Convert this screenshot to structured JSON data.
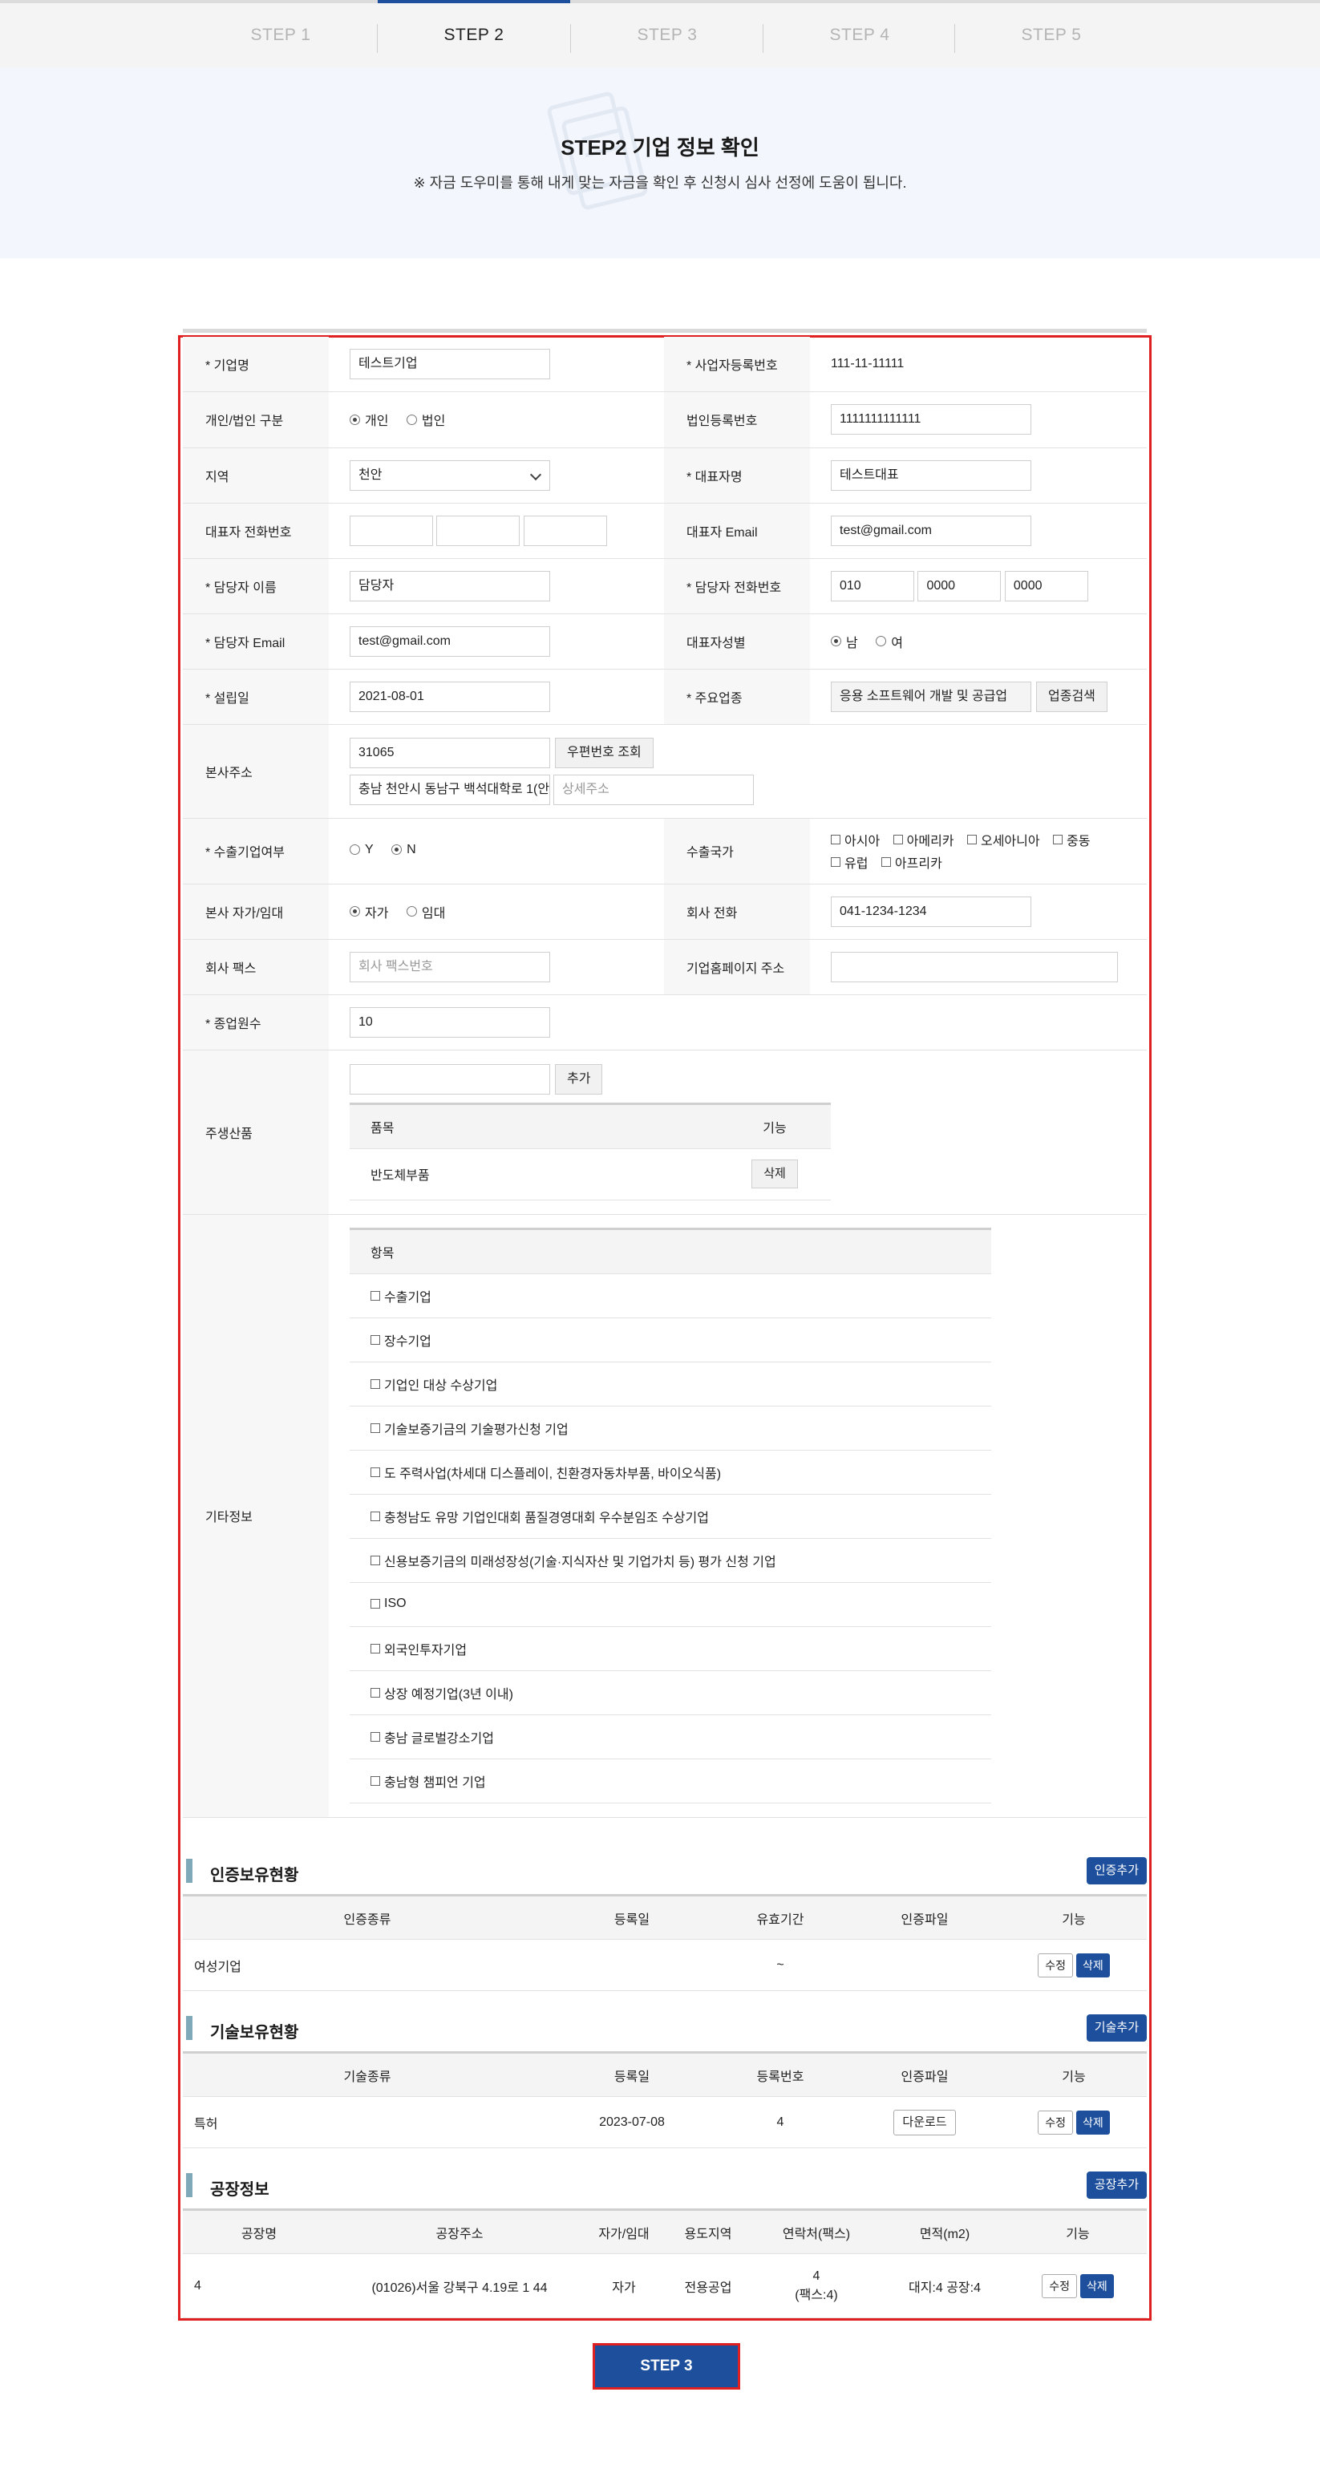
{
  "steps": [
    "STEP 1",
    "STEP 2",
    "STEP 3",
    "STEP 4",
    "STEP 5"
  ],
  "active_step_index": 1,
  "hero": {
    "title": "STEP2 기업 정보 확인",
    "subtitle": "※ 자금 도우미를 통해 내게 맞는 자금을 확인 후 신청시 심사 선정에 도움이 됩니다."
  },
  "form": {
    "company_name": {
      "label": "* 기업명",
      "value": "테스트기업"
    },
    "biz_reg_no": {
      "label": "* 사업자등록번호",
      "value": "111-11-11111"
    },
    "entity_type": {
      "label": "개인/법인 구분",
      "options": [
        "개인",
        "법인"
      ],
      "selected": "개인"
    },
    "corp_reg_no": {
      "label": "법인등록번호",
      "value": "1111111111111"
    },
    "region": {
      "label": "지역",
      "value": "천안"
    },
    "ceo_name": {
      "label": "* 대표자명",
      "value": "테스트대표"
    },
    "ceo_phone": {
      "label": "대표자 전화번호",
      "values": [
        "",
        "",
        ""
      ]
    },
    "ceo_email": {
      "label": "대표자 Email",
      "value": "test@gmail.com"
    },
    "manager_name": {
      "label": "* 담당자 이름",
      "value": "담당자"
    },
    "manager_phone": {
      "label": "* 담당자 전화번호",
      "values": [
        "010",
        "0000",
        "0000"
      ]
    },
    "manager_email": {
      "label": "* 담당자 Email",
      "value": "test@gmail.com"
    },
    "ceo_gender": {
      "label": "대표자성별",
      "options": [
        "남",
        "여"
      ],
      "selected": "남"
    },
    "founded": {
      "label": "* 설립일",
      "value": "2021-08-01"
    },
    "main_industry": {
      "label": "* 주요업종",
      "value": "응용 소프트웨어 개발 및 공급업",
      "button": "업종검색"
    },
    "hq_address": {
      "label": "본사주소",
      "zipcode": "31065",
      "zip_button": "우편번호 조회",
      "address": "충남 천안시 동남구 백석대학로 1(안",
      "detail_placeholder": "상세주소"
    },
    "exporter": {
      "label": "* 수출기업여부",
      "options": [
        "Y",
        "N"
      ],
      "selected": "N"
    },
    "export_countries": {
      "label": "수출국가",
      "options": [
        "아시아",
        "아메리카",
        "오세아니아",
        "중동",
        "유럽",
        "아프리카"
      ]
    },
    "hq_ownership": {
      "label": "본사 자가/임대",
      "options": [
        "자가",
        "임대"
      ],
      "selected": "자가"
    },
    "company_phone": {
      "label": "회사 전화",
      "value": "041-1234-1234"
    },
    "company_fax": {
      "label": "회사 팩스",
      "placeholder": "회사 팩스번호"
    },
    "homepage": {
      "label": "기업홈페이지 주소",
      "value": ""
    },
    "employees": {
      "label": "* 종업원수",
      "value": "10"
    },
    "main_products": {
      "label": "주생산품",
      "add_button": "추가",
      "col_item": "품목",
      "col_action": "기능",
      "rows": [
        {
          "item": "반도체부품",
          "action": "삭제"
        }
      ]
    },
    "etc_info": {
      "label": "기타정보",
      "col": "항목",
      "items": [
        "수출기업",
        "장수기업",
        "기업인 대상 수상기업",
        "기술보증기금의 기술평가신청 기업",
        "도 주력사업(차세대 디스플레이, 친환경자동차부품, 바이오식품)",
        "충청남도 유망 기업인대회 품질경영대회 우수분임조 수상기업",
        "신용보증기금의 미래성장성(기술·지식자산 및 기업가치 등) 평가 신청 기업",
        "ISO",
        "외국인투자기업",
        "상장 예정기업(3년 이내)",
        "충남 글로벌강소기업",
        "충남형 챔피언 기업"
      ]
    }
  },
  "certifications": {
    "title": "인증보유현황",
    "add_button": "인증추가",
    "columns": [
      "인증종류",
      "등록일",
      "유효기간",
      "인증파일",
      "기능"
    ],
    "rows": [
      {
        "type": "여성기업",
        "reg_date": "",
        "validity": "~",
        "file": "",
        "edit": "수정",
        "delete": "삭제"
      }
    ]
  },
  "technologies": {
    "title": "기술보유현황",
    "add_button": "기술추가",
    "columns": [
      "기술종류",
      "등록일",
      "등록번호",
      "인증파일",
      "기능"
    ],
    "rows": [
      {
        "type": "특허",
        "reg_date": "2023-07-08",
        "reg_no": "4",
        "file": "다운로드",
        "edit": "수정",
        "delete": "삭제"
      }
    ]
  },
  "factories": {
    "title": "공장정보",
    "add_button": "공장추가",
    "columns": [
      "공장명",
      "공장주소",
      "자가/임대",
      "용도지역",
      "연락처(팩스)",
      "면적(m2)",
      "기능"
    ],
    "rows": [
      {
        "name": "4",
        "address": "(01026)서울 강북구 4.19로 1 44",
        "ownership": "자가",
        "zone": "전용공업",
        "contact": "4",
        "fax": "(팩스:4)",
        "area": "대지:4 공장:4",
        "edit": "수정",
        "delete": "삭제"
      }
    ]
  },
  "next_button": "STEP 3"
}
